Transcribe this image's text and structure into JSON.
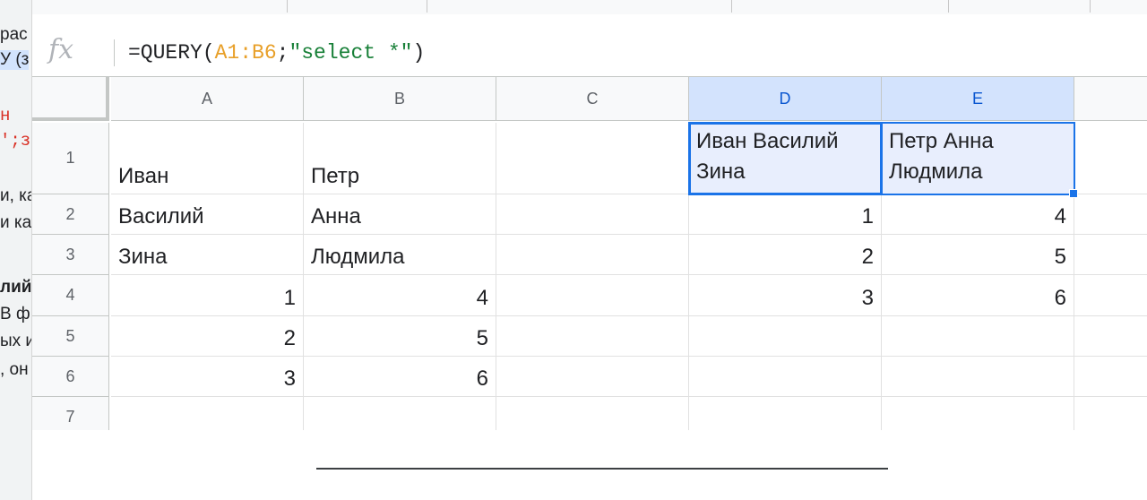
{
  "background_text": [
    "рас",
    "У (з",
    "н",
    "';з",
    "и, ка",
    "и ка",
    "лий",
    "В ф",
    "ых и",
    ", он"
  ],
  "formula_bar": {
    "fx_label": "fx",
    "formula_parts": [
      {
        "text": "=QUERY(",
        "kind": "plain"
      },
      {
        "text": "A1:B6",
        "kind": "ref"
      },
      {
        "text": ";",
        "kind": "plain"
      },
      {
        "text": "\"select *\"",
        "kind": "str"
      },
      {
        "text": ")",
        "kind": "plain"
      }
    ]
  },
  "columns": [
    "A",
    "B",
    "C",
    "D",
    "E"
  ],
  "rows": [
    "1",
    "2",
    "3",
    "4",
    "5",
    "6",
    "7"
  ],
  "cells": {
    "A1": "Иван",
    "B1": "Петр",
    "A2": "Василий",
    "B2": "Анна",
    "A3": "Зина",
    "B3": "Людмила",
    "A4": "1",
    "B4": "4",
    "A5": "2",
    "B5": "5",
    "A6": "3",
    "B6": "6",
    "D1": "Иван Василий Зина",
    "E1": "Петр Анна Людмила",
    "D2": "1",
    "E2": "4",
    "D3": "2",
    "E3": "5",
    "D4": "3",
    "E4": "6"
  },
  "selection": {
    "range": "D1:E1",
    "active": "D1"
  },
  "colors": {
    "selection": "#1a73e8",
    "ref": "#e8a02a",
    "string": "#188038"
  }
}
